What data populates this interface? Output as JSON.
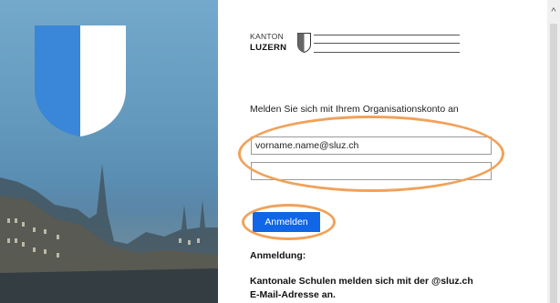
{
  "branding": {
    "logo_line1": "KANTON",
    "logo_line2": "LUZERN"
  },
  "login": {
    "prompt": "Melden Sie sich mit Ihrem Organisationskonto an",
    "email_value": "vorname.name@sluz.ch",
    "password_value": "",
    "submit_label": "Anmelden"
  },
  "info": {
    "heading": "Anmeldung:",
    "line1": "Kantonale Schulen melden sich mit der @sluz.ch",
    "line2": "E-Mail-Adresse an."
  },
  "scrollbar": {
    "up_glyph": "^"
  },
  "colors": {
    "accent": "#1166e8",
    "highlight": "#f0a25a",
    "crest_blue": "#3a86d8"
  }
}
